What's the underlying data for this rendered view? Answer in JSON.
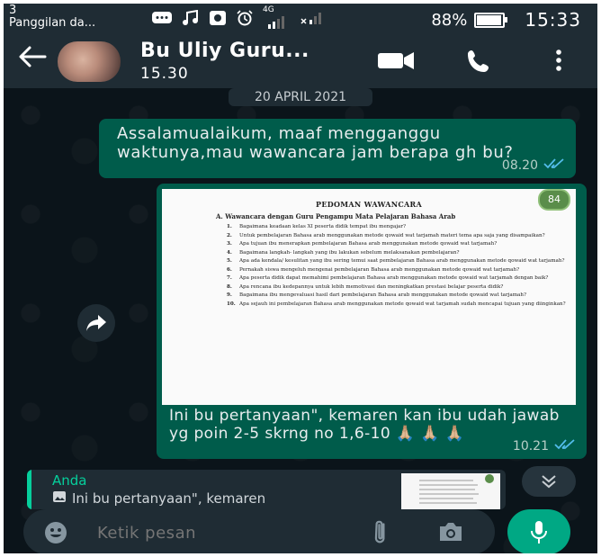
{
  "status_bar": {
    "notification_count": "3",
    "notification_text": "Panggilan da...",
    "network": "4G",
    "battery_percent": "88%",
    "battery_level": 0.88,
    "time": "15:33"
  },
  "header": {
    "contact_name": "Bu Uliy Guru...",
    "last_seen": "15.30"
  },
  "chat": {
    "date_label": "20 APRIL 2021",
    "messages": [
      {
        "text": "Assalamualaikum, maaf mengganggu waktunya,mau wawancara jam berapa gh bu?",
        "time": "08.20"
      },
      {
        "image_page_count": "84",
        "document": {
          "title": "PEDOMAN WAWANCARA",
          "subtitle": "A.  Wawancara dengan Guru Pengampu Mata Pelajaran Bahasa Arab",
          "items": [
            {
              "n": "1.",
              "text": "Bagaimana keadaan kelas   XI peserta didik tempat ibu mengajar?"
            },
            {
              "n": "2.",
              "text": "Untuk pembelajaran Bahasa arab menggunakan metode qowaid wat tarjamah materi tema apa saja yang disampaikan?"
            },
            {
              "n": "3.",
              "text": "Apa tujuan ibu menerapkan pembelajaran Bahasa arab menggunakan metode qowaid wat tarjamah?"
            },
            {
              "n": "4.",
              "text": "Bagaimana langkah- langkah yang ibu lakukan sebelum melaksanakan pembelajaran?"
            },
            {
              "n": "5.",
              "text": "Apa ada kendala/ kesulitan yang ibu sering temui saat pembelajaran Bahasa arab menggunakan metode qowaid wat tarjamah?"
            },
            {
              "n": "6.",
              "text": "Pernakah siswa mengeluh mengenai pembelajaran  Bahasa arab menggunakan metode qowaid wat tarjamah?"
            },
            {
              "n": "7.",
              "text": "Apa peserta didik dapat memahimi pembelajaran   Bahasa arab menggunakan metode qowaid wat tarjamah dengan baik?"
            },
            {
              "n": "8.",
              "text": "Apa rencana ibu kedepannya untuk lebih memotivasi dan meningkatkan prestasi belajar peserta didik?"
            },
            {
              "n": "9.",
              "text": "Bagaimana ibu mengevaluasi hasil dari pembelajaran  Bahasa arab menggunakan metode qowaid wat tarjamah?"
            },
            {
              "n": "10.",
              "text": "Apa sejauh ini pembelajaran  Bahasa arab menggunakan metode qowaid wat tarjamah sudah mencapai tujuan yang diinginkan?"
            }
          ]
        },
        "caption": "Ini bu pertanyaan\", kemaren kan ibu udah jawab yg poin 2-5 skrng no 1,6-10 🙏🏼 🙏🏼 🙏🏼",
        "time": "10.21"
      }
    ]
  },
  "reply_preview": {
    "sender": "Anda",
    "text": "Ini bu pertanyaan\", kemaren"
  },
  "composer": {
    "placeholder": "Ketik pesan"
  },
  "colors": {
    "outgoing_bubble": "#005c4b",
    "header": "#1f2c34",
    "accent": "#00a884",
    "read_ticks": "#53bdeb"
  },
  "icons": [
    "back-arrow-icon",
    "video-call-icon",
    "phone-icon",
    "more-vert-icon",
    "forward-icon",
    "double-check-icon",
    "chevrons-down-icon",
    "emoji-icon",
    "attach-icon",
    "camera-icon",
    "mic-icon",
    "image-icon"
  ]
}
